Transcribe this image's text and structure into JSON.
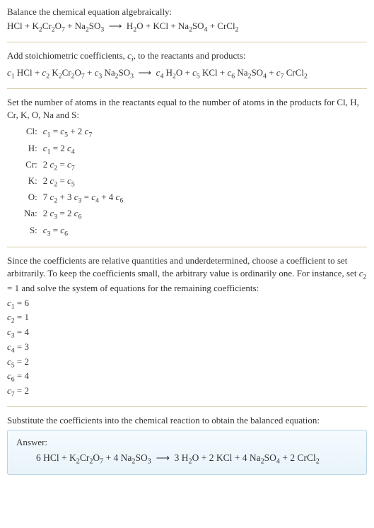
{
  "section1": {
    "intro": "Balance the chemical equation algebraically:",
    "eq_html": "HCl + K<sub>2</sub>Cr<sub>2</sub>O<sub>7</sub> + Na<sub>2</sub>SO<sub>3</sub> &nbsp;⟶&nbsp; H<sub>2</sub>O + KCl + Na<sub>2</sub>SO<sub>4</sub> + CrCl<sub>2</sub>"
  },
  "section2": {
    "intro_html": "Add stoichiometric coefficients, <i>c<sub>i</sub></i>, to the reactants and products:",
    "eq_html": "<i>c</i><sub>1</sub> HCl + <i>c</i><sub>2</sub> K<sub>2</sub>Cr<sub>2</sub>O<sub>7</sub> + <i>c</i><sub>3</sub> Na<sub>2</sub>SO<sub>3</sub> &nbsp;⟶&nbsp; <i>c</i><sub>4</sub> H<sub>2</sub>O + <i>c</i><sub>5</sub> KCl + <i>c</i><sub>6</sub> Na<sub>2</sub>SO<sub>4</sub> + <i>c</i><sub>7</sub> CrCl<sub>2</sub>"
  },
  "section3": {
    "intro": "Set the number of atoms in the reactants equal to the number of atoms in the products for Cl, H, Cr, K, O, Na and S:",
    "rows": [
      {
        "el": "Cl:",
        "eq_html": "<i>c</i><sub>1</sub> = <i>c</i><sub>5</sub> + 2 <i>c</i><sub>7</sub>"
      },
      {
        "el": "H:",
        "eq_html": "<i>c</i><sub>1</sub> = 2 <i>c</i><sub>4</sub>"
      },
      {
        "el": "Cr:",
        "eq_html": "2 <i>c</i><sub>2</sub> = <i>c</i><sub>7</sub>"
      },
      {
        "el": "K:",
        "eq_html": "2 <i>c</i><sub>2</sub> = <i>c</i><sub>5</sub>"
      },
      {
        "el": "O:",
        "eq_html": "7 <i>c</i><sub>2</sub> + 3 <i>c</i><sub>3</sub> = <i>c</i><sub>4</sub> + 4 <i>c</i><sub>6</sub>"
      },
      {
        "el": "Na:",
        "eq_html": "2 <i>c</i><sub>3</sub> = 2 <i>c</i><sub>6</sub>"
      },
      {
        "el": "S:",
        "eq_html": "<i>c</i><sub>3</sub> = <i>c</i><sub>6</sub>"
      }
    ]
  },
  "section4": {
    "intro_html": "Since the coefficients are relative quantities and underdetermined, choose a coefficient to set arbitrarily. To keep the coefficients small, the arbitrary value is ordinarily one. For instance, set <i>c</i><sub>2</sub> = 1 and solve the system of equations for the remaining coefficients:",
    "coeffs": [
      "<i>c</i><sub>1</sub> = 6",
      "<i>c</i><sub>2</sub> = 1",
      "<i>c</i><sub>3</sub> = 4",
      "<i>c</i><sub>4</sub> = 3",
      "<i>c</i><sub>5</sub> = 2",
      "<i>c</i><sub>6</sub> = 4",
      "<i>c</i><sub>7</sub> = 2"
    ]
  },
  "section5": {
    "intro": "Substitute the coefficients into the chemical reaction to obtain the balanced equation:",
    "answer_label": "Answer:",
    "answer_eq_html": "6 HCl + K<sub>2</sub>Cr<sub>2</sub>O<sub>7</sub> + 4 Na<sub>2</sub>SO<sub>3</sub> &nbsp;⟶&nbsp; 3 H<sub>2</sub>O + 2 KCl + 4 Na<sub>2</sub>SO<sub>4</sub> + 2 CrCl<sub>2</sub>"
  }
}
